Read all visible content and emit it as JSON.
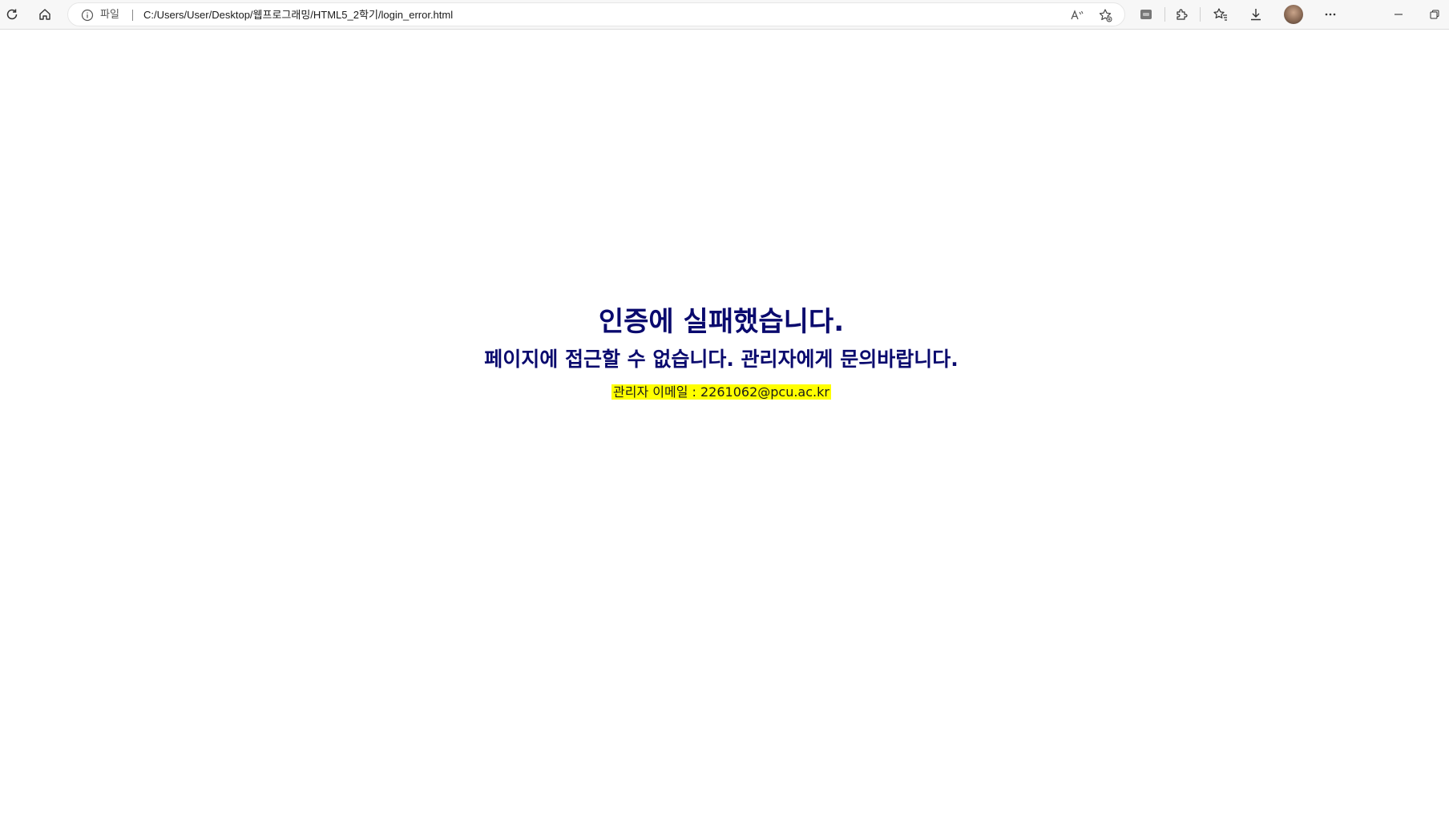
{
  "browser": {
    "scheme_label": "파일",
    "url": "C:/Users/User/Desktop/웹프로그래밍/HTML5_2학기/login_error.html",
    "icons": {
      "refresh": "refresh-icon",
      "home": "home-icon",
      "info": "info-icon",
      "read_aloud": "read-aloud-icon",
      "favorite_add": "add-favorite-icon",
      "extension_app": "app-icon",
      "extensions": "extensions-icon",
      "favorites": "favorites-icon",
      "downloads": "download-icon",
      "profile": "avatar",
      "more": "more-icon",
      "minimize": "minimize-icon",
      "restore": "restore-icon"
    }
  },
  "page": {
    "title": "인증에 실패했습니다.",
    "subtitle": "페이지에 접근할 수 없습니다. 관리자에게 문의바랍니다.",
    "admin_email": "관리자 이메일 : 2261062@pcu.ac.kr",
    "colors": {
      "heading": "#0a0a6e",
      "highlight": "#ffff00"
    }
  }
}
